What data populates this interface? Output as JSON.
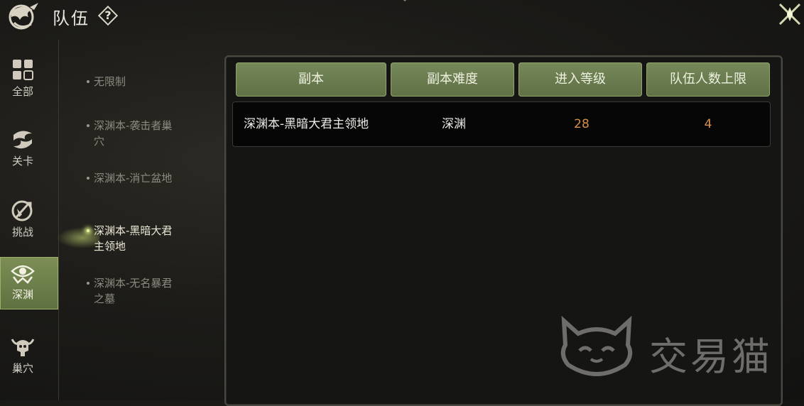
{
  "header": {
    "title": "队伍",
    "help_label": "?"
  },
  "nav": [
    {
      "label": "全部",
      "icon": "grid-icon",
      "active": false
    },
    {
      "label": "关卡",
      "icon": "swirl-emblem-icon",
      "active": false
    },
    {
      "label": "挑战",
      "icon": "sword-shield-icon",
      "active": false
    },
    {
      "label": "深渊",
      "icon": "eye-emblem-icon",
      "active": true
    },
    {
      "label": "巢穴",
      "icon": "horned-skull-icon",
      "active": false
    }
  ],
  "dungeons": [
    {
      "label": "无限制",
      "active": false
    },
    {
      "label": "深渊本-袭击者巢穴",
      "active": false
    },
    {
      "label": "深渊本-消亡盆地",
      "active": false
    },
    {
      "label": "深渊本-黑暗大君主领地",
      "active": true
    },
    {
      "label": "深渊本-无名暴君之墓",
      "active": false
    }
  ],
  "table": {
    "headers": [
      "副本",
      "副本难度",
      "进入等级",
      "队伍人数上限"
    ],
    "rows": [
      {
        "dungeon": "深渊本-黑暗大君主领地",
        "difficulty": "深渊",
        "entry_level": "28",
        "max_members": "4"
      }
    ]
  },
  "watermark": {
    "text": "交易猫"
  },
  "colors": {
    "accent_green": "#6f8150",
    "number_orange": "#d9904a"
  }
}
